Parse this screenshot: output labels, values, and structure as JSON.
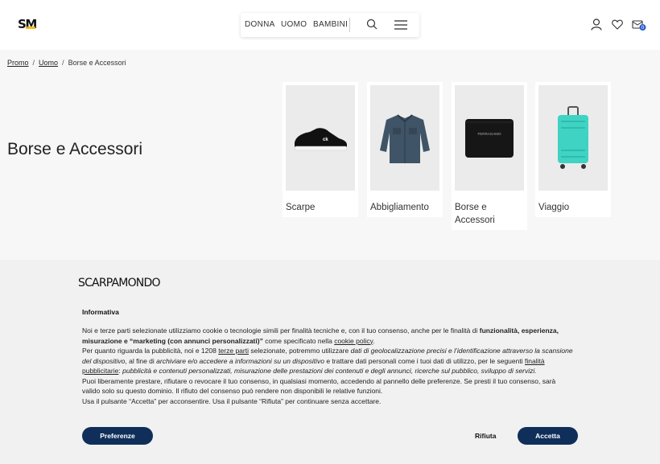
{
  "header": {
    "logo_text_s": "S",
    "logo_text_m": "M",
    "nav": [
      "DONNA",
      "UOMO",
      "BAMBINI"
    ],
    "icons": {
      "search": "search-icon",
      "menu": "menu-icon",
      "user": "user-icon",
      "wishlist": "heart-icon",
      "cart": "cart-icon"
    },
    "cart_count": "0"
  },
  "breadcrumb": {
    "items": [
      "Promo",
      "Uomo"
    ],
    "current": "Borse e Accessori"
  },
  "page_title": "Borse e Accessori",
  "categories": [
    {
      "label": "Scarpe",
      "image": "sneaker-image"
    },
    {
      "label": "Abbigliamento",
      "image": "denim-shirt-image"
    },
    {
      "label": "Borse e Accessori",
      "image": "wallet-image"
    },
    {
      "label": "Viaggio",
      "image": "suitcase-image"
    }
  ],
  "cookie_banner": {
    "brand_pre": "SCARP",
    "brand_hl": "AM",
    "brand_post": "ONDO",
    "title": "Informativa",
    "p1_a": "Noi e terze parti selezionate utilizziamo cookie o tecnologie simili per finalità tecniche e, con il tuo consenso, anche per le finalità di ",
    "p1_b": "funzionalità, esperienza, misurazione e “marketing (con annunci personalizzati)”",
    "p1_c": " come specificato nella ",
    "p1_link": "cookie policy",
    "p1_d": ".",
    "p2_a": "Per quanto riguarda la pubblicità, noi e 1208 ",
    "p2_link1": "terze parti",
    "p2_b": " selezionate, potremmo utilizzare ",
    "p2_i1": "dati di geolocalizzazione precisi e l’identificazione attraverso la scansione del dispositivo",
    "p2_c": ", al fine di ",
    "p2_i2": "archiviare e/o accedere a informazioni su un dispositivo",
    "p2_d": " e trattare dati personali come i tuoi dati di utilizzo, per le seguenti ",
    "p2_link2": "finalità pubblicitarie",
    "p2_e": ": ",
    "p2_i3": "pubblicità e contenuti personalizzati, misurazione delle prestazioni dei contenuti e degli annunci, ricerche sul pubblico, sviluppo di servizi.",
    "p3": "Puoi liberamente prestare, rifiutare o revocare il tuo consenso, in qualsiasi momento, accedendo al pannello delle preferenze. Se presti il tuo consenso, sarà valido solo su questo dominio. Il rifiuto del consenso può rendere non disponibili le relative funzioni.",
    "p4": "Usa il pulsante “Accetta” per acconsentire. Usa il pulsante “Rifiuta” per continuare senza accettare.",
    "btn_preferences": "Preferenze",
    "btn_reject": "Rifiuta",
    "btn_accept": "Accetta",
    "button_color": "#0f2f5a"
  }
}
